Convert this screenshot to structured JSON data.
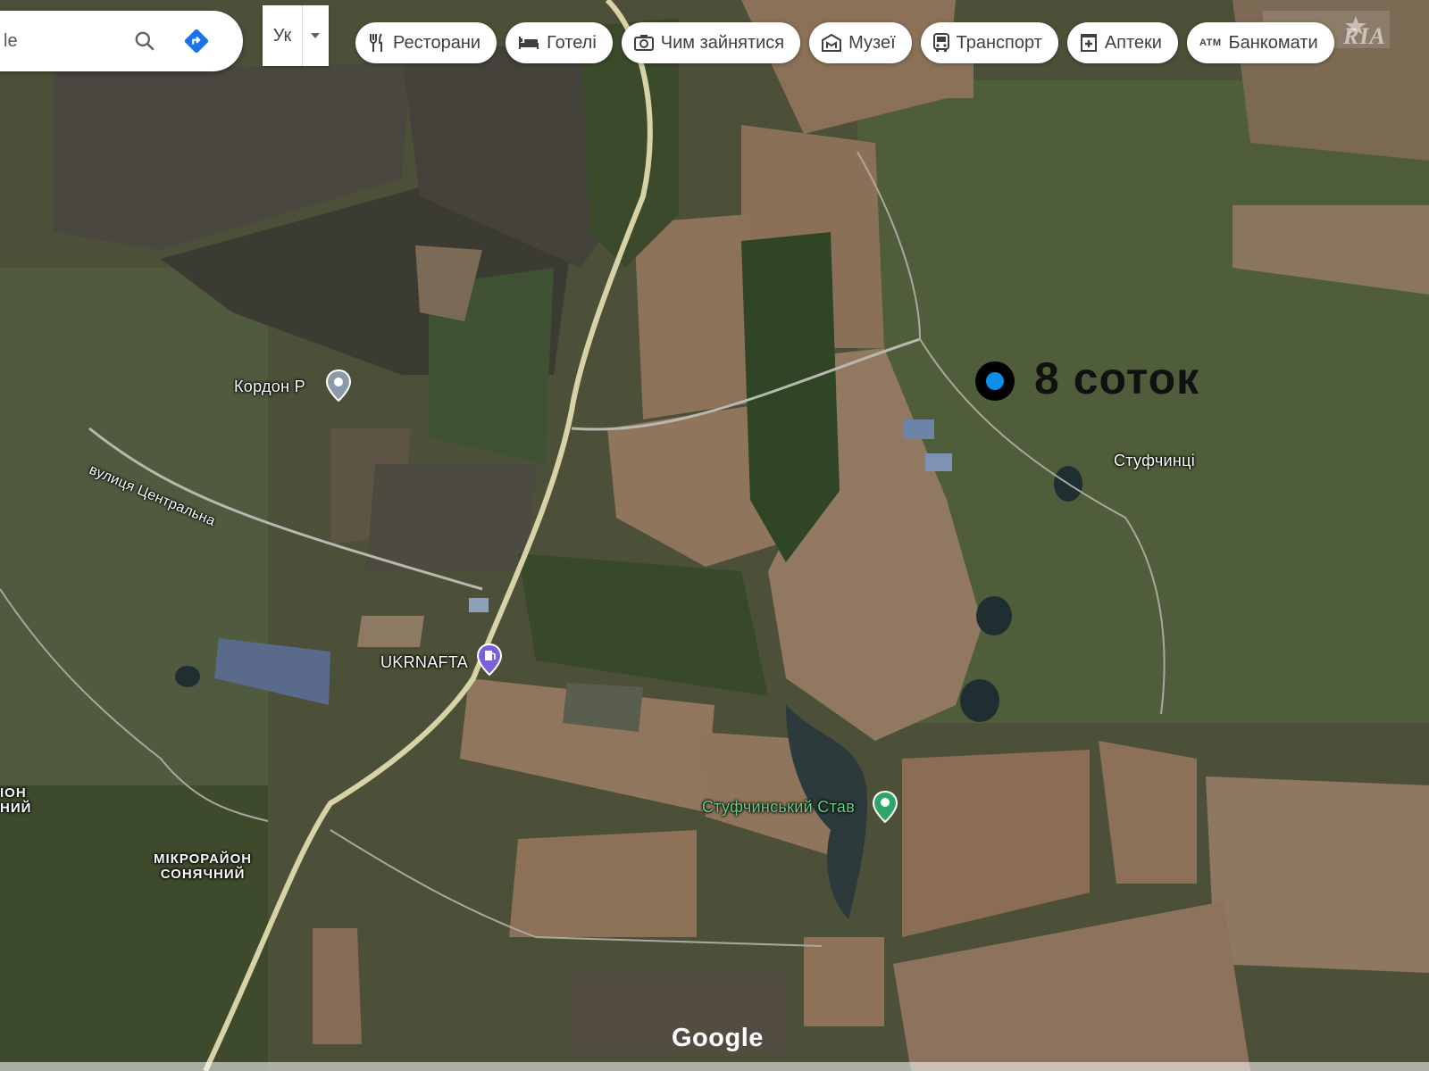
{
  "search": {
    "value": "le"
  },
  "language": {
    "code": "Ук"
  },
  "chips": [
    {
      "label": "Ресторани",
      "icon": "fork-knife-icon"
    },
    {
      "label": "Готелі",
      "icon": "bed-icon"
    },
    {
      "label": "Чим зайнятися",
      "icon": "camera-icon"
    },
    {
      "label": "Музеї",
      "icon": "museum-icon"
    },
    {
      "label": "Транспорт",
      "icon": "bus-icon"
    },
    {
      "label": "Аптеки",
      "icon": "pharmacy-icon"
    },
    {
      "label": "Банкомати",
      "icon": "atm-icon",
      "icon_text": "ATM"
    }
  ],
  "map": {
    "places": {
      "kordon": "Кордон Р",
      "ukrnafta": "UKRNAFTA",
      "stufchynskyi_stav": "Стуфчинський Став",
      "stufchyntsi": "Стуфчинці",
      "street": "вулиця Центральна",
      "mikroraion": "МІКРОРАЙОН",
      "sonyachnyi": "СОНЯЧНИЙ",
      "partial_top": "ІОН",
      "partial_bottom": "НИЙ"
    },
    "marker_label": "8 соток",
    "google": "Google",
    "watermark": "RIA"
  },
  "colors": {
    "marker_blue": "#0a8ee8",
    "pin_gray": "#8a9aa8",
    "pin_purple": "#7b61d6",
    "pin_green": "#2da56b",
    "directions_blue": "#1a73e8"
  }
}
